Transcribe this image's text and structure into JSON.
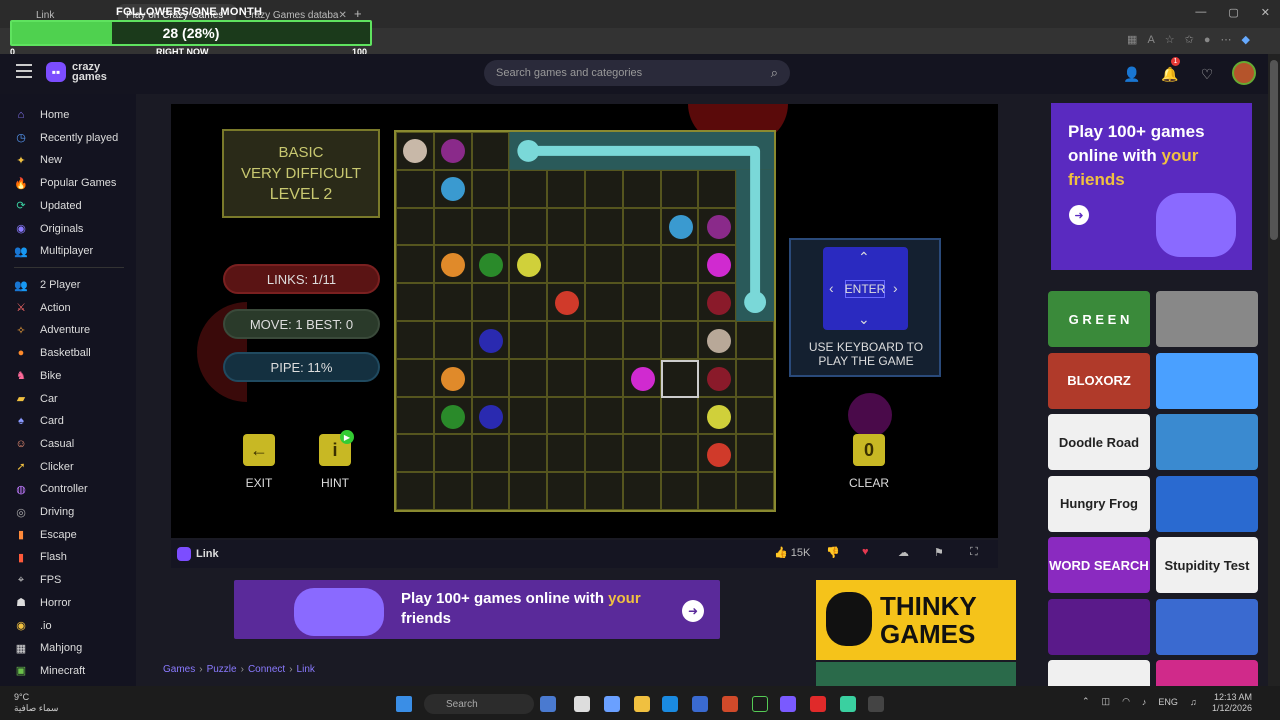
{
  "browser": {
    "tabs": [
      {
        "label": "Link",
        "active": false
      },
      {
        "label": "Play on Crazy Games",
        "active": true
      },
      {
        "label": "Crazy Games databa",
        "active": false
      }
    ],
    "new_tab": "+"
  },
  "overlay": {
    "title": "FOLLOWERS/ONE MONTH",
    "progress_text": "28 (28%)",
    "progress_percent": 28,
    "min": "0",
    "now": "RIGHT NOW",
    "max": "100"
  },
  "header": {
    "logo_line1": "crazy",
    "logo_line2": "games",
    "search_placeholder": "Search games and categories",
    "notif_count": "1"
  },
  "sidebar": {
    "primary": [
      {
        "label": "Home",
        "icon": "home-icon",
        "glyph": "⌂",
        "color": "#8a7aff"
      },
      {
        "label": "Recently played",
        "icon": "history-icon",
        "glyph": "◷",
        "color": "#5aa0ff"
      },
      {
        "label": "New",
        "icon": "sparkle-icon",
        "glyph": "✦",
        "color": "#f0c040"
      },
      {
        "label": "Popular Games",
        "icon": "fire-icon",
        "glyph": "🔥",
        "color": "#ff6a2a"
      },
      {
        "label": "Updated",
        "icon": "refresh-icon",
        "glyph": "⟳",
        "color": "#3ad0a0"
      },
      {
        "label": "Originals",
        "icon": "originals-icon",
        "glyph": "◉",
        "color": "#8a7aff"
      },
      {
        "label": "Multiplayer",
        "icon": "multiplayer-icon",
        "glyph": "👥",
        "color": "#b07aff"
      }
    ],
    "categories": [
      {
        "label": "2 Player",
        "icon": "two-player-icon",
        "glyph": "👥",
        "color": "#8a7aff"
      },
      {
        "label": "Action",
        "icon": "sword-icon",
        "glyph": "⚔",
        "color": "#ff6a6a"
      },
      {
        "label": "Adventure",
        "icon": "compass-icon",
        "glyph": "✧",
        "color": "#ffaa3a"
      },
      {
        "label": "Basketball",
        "icon": "basketball-icon",
        "glyph": "●",
        "color": "#ff8a2a"
      },
      {
        "label": "Bike",
        "icon": "bike-icon",
        "glyph": "♞",
        "color": "#ff6a9a"
      },
      {
        "label": "Car",
        "icon": "car-icon",
        "glyph": "▰",
        "color": "#f0c040"
      },
      {
        "label": "Card",
        "icon": "card-icon",
        "glyph": "♠",
        "color": "#8a9aff"
      },
      {
        "label": "Casual",
        "icon": "casual-icon",
        "glyph": "☺",
        "color": "#ff9a7a"
      },
      {
        "label": "Clicker",
        "icon": "cursor-icon",
        "glyph": "➚",
        "color": "#f0c040"
      },
      {
        "label": "Controller",
        "icon": "gamepad-icon",
        "glyph": "◍",
        "color": "#c07aff"
      },
      {
        "label": "Driving",
        "icon": "steering-icon",
        "glyph": "◎",
        "color": "#aaa"
      },
      {
        "label": "Escape",
        "icon": "door-icon",
        "glyph": "▮",
        "color": "#ff8a3a"
      },
      {
        "label": "Flash",
        "icon": "flash-icon",
        "glyph": "▮",
        "color": "#ff5a3a"
      },
      {
        "label": "FPS",
        "icon": "crosshair-icon",
        "glyph": "⌖",
        "color": "#ccc"
      },
      {
        "label": "Horror",
        "icon": "ghost-icon",
        "glyph": "☗",
        "color": "#ddd"
      },
      {
        "label": ".io",
        "icon": "io-icon",
        "glyph": "◉",
        "color": "#f0c040"
      },
      {
        "label": "Mahjong",
        "icon": "mahjong-icon",
        "glyph": "▦",
        "color": "#ddd"
      },
      {
        "label": "Minecraft",
        "icon": "minecraft-icon",
        "glyph": "▣",
        "color": "#6ac04a"
      }
    ]
  },
  "game": {
    "level_mode": "BASIC",
    "difficulty": "VERY DIFFICULT",
    "level": "LEVEL  2",
    "links": "LINKS:   1/11",
    "move_best": "MOVE: 1    BEST: 0",
    "pipe": "PIPE:   11%",
    "exit_label": "EXIT",
    "hint_label": "HINT",
    "hint_icon": "i",
    "hint_badge": "▶",
    "keyboard_key": "ENTER",
    "keyboard_text": "USE KEYBOARD TO PLAY THE GAME",
    "clear_count": "0",
    "clear_label": "CLEAR",
    "colors": {
      "pipe": "#7ad8d8",
      "grid_line": "#8a8a30"
    }
  },
  "gamebar": {
    "title": "Link",
    "likes": "15K"
  },
  "ad_banner": {
    "text_a": "Play 100+ games online with ",
    "text_b": "your",
    "text_c": " friends"
  },
  "thinky_ad": {
    "text": "THINKY GAMES"
  },
  "breadcrumb": [
    "Games",
    "Puzzle",
    "Connect",
    "Link"
  ],
  "right_ad": {
    "text_a": "Play 100+ games online with ",
    "text_b": "your friends"
  },
  "thumbnails": [
    {
      "label": "G R E E N",
      "bg": "#3a8a3a"
    },
    {
      "label": "",
      "bg": "#888"
    },
    {
      "label": "BLOXORZ",
      "bg": "#b03a2a"
    },
    {
      "label": "",
      "bg": "#4aa0ff"
    },
    {
      "label": "Doodle Road",
      "bg": "#f0f0f0"
    },
    {
      "label": "",
      "bg": "#3a8ad0"
    },
    {
      "label": "Hungry Frog",
      "bg": "#f0f0f0"
    },
    {
      "label": "",
      "bg": "#2a6ad0"
    },
    {
      "label": "WORD SEARCH",
      "bg": "#8a2ac0"
    },
    {
      "label": "Stupidity Test",
      "bg": "#f0f0f0"
    },
    {
      "label": "",
      "bg": "#5a1a8a"
    },
    {
      "label": "",
      "bg": "#3a6ad0"
    },
    {
      "label": "",
      "bg": "#f0f0f0"
    },
    {
      "label": "",
      "bg": "#d02a8a"
    }
  ],
  "taskbar": {
    "weather_temp": "9°C",
    "weather_desc": "سماء صافية",
    "search": "Search",
    "lang": "ENG",
    "time": "12:13 AM",
    "date": "1/12/2026"
  }
}
